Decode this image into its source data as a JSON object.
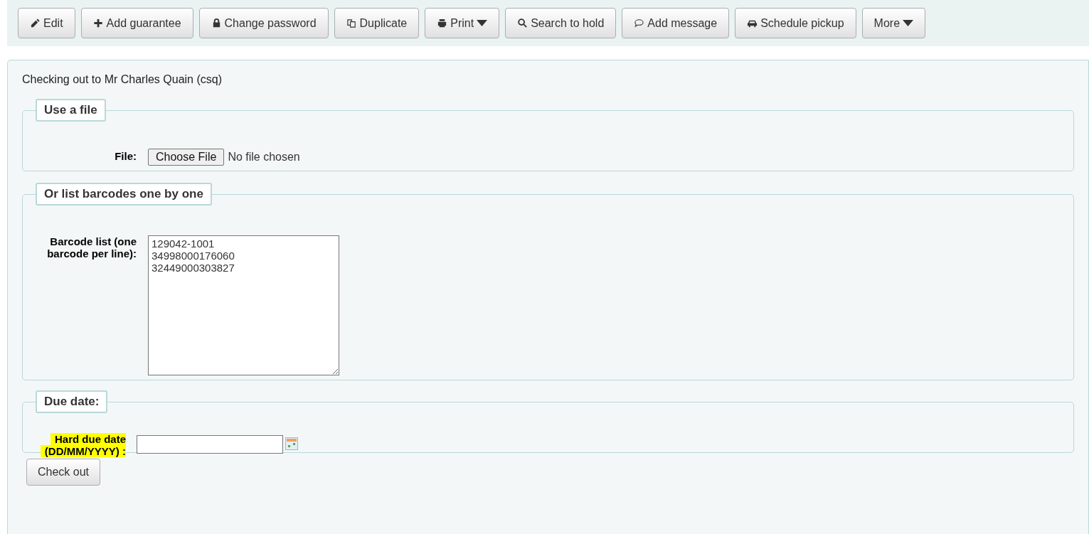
{
  "toolbar": {
    "buttons": [
      {
        "label": "Edit",
        "dropdown": false
      },
      {
        "label": "Add guarantee",
        "dropdown": false
      },
      {
        "label": "Change password",
        "dropdown": false
      },
      {
        "label": "Duplicate",
        "dropdown": false
      },
      {
        "label": "Print",
        "dropdown": true
      },
      {
        "label": "Search to hold",
        "dropdown": false
      },
      {
        "label": "Add message",
        "dropdown": false
      },
      {
        "label": "Schedule pickup",
        "dropdown": false
      },
      {
        "label": "More",
        "dropdown": true
      }
    ]
  },
  "heading": "Checking out to Mr Charles Quain (csq)",
  "file_section": {
    "legend": "Use a file",
    "label": "File:",
    "button": "Choose File",
    "status": "No file chosen"
  },
  "barcode_section": {
    "legend": "Or list barcodes one by one",
    "label": "Barcode list (one barcode per line):",
    "value": "129042-1001\n34998000176060\n32449000303827"
  },
  "due_section": {
    "legend": "Due date:",
    "label_lines": [
      "Hard due date",
      "(DD/MM/YYYY) :"
    ],
    "highlighted": true
  },
  "submit": "Check out"
}
